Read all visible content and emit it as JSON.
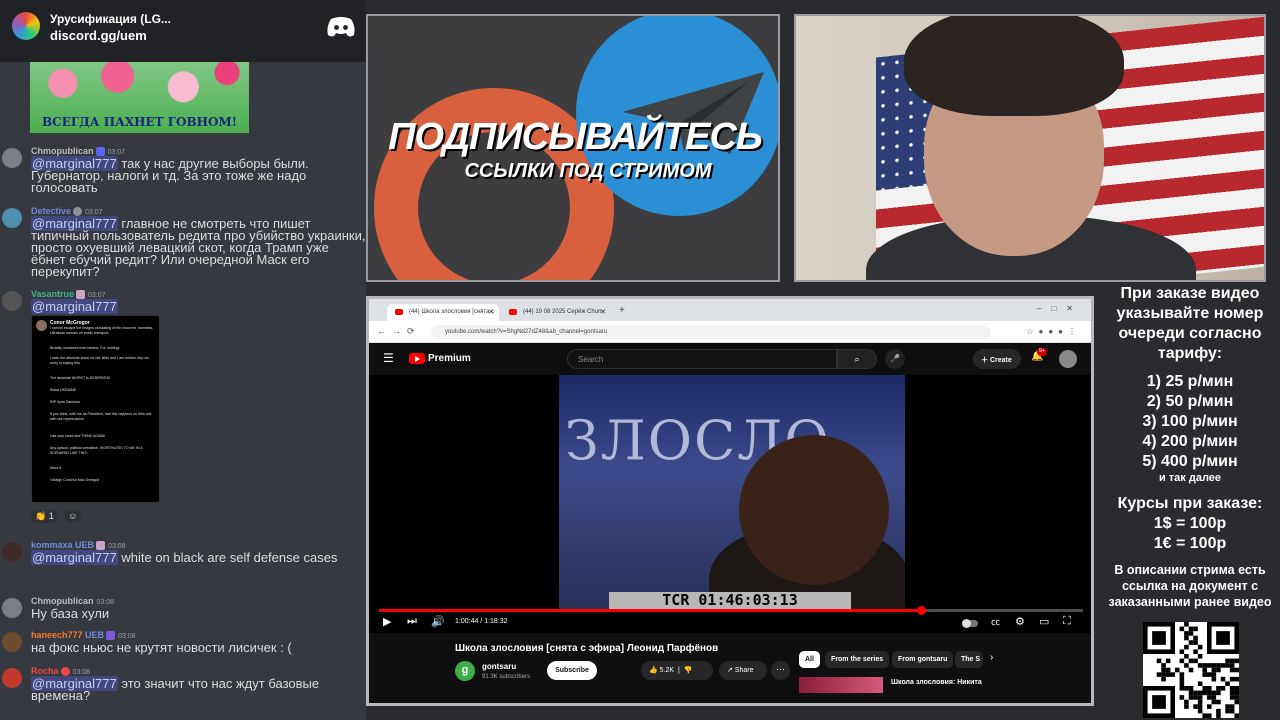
{
  "discord": {
    "server_name": "Урусификация (LG...",
    "invite_link": "discord.gg/uem",
    "image_caption": "ВСЕГДА ПАХНЕТ ГОВНОМ!",
    "messages": [
      {
        "author": "Chmopublican",
        "time": "03:07",
        "author_color": "#b9bbbe",
        "mention": "@marginal777",
        "text": " так у нас другие выборы были. Губернатор, налоги и тд. За это тоже же надо голосовать"
      },
      {
        "author": "Detective",
        "time": "03:07",
        "author_color": "#7289da",
        "mention": "@marginal777",
        "text": " главное не смотреть что пишет типичный пользователь редита про убийство украинки, просто охуевший левацкий скот, когда Трамп уже ёбнет ебучий редит? Или очередной Маск его перекупит?"
      },
      {
        "author": "Vasantrue",
        "time": "03:07",
        "author_color": "#43b581",
        "mention": "@marginal777",
        "text": ""
      },
      {
        "author": "kommaxa",
        "time": "03:08",
        "author_color": "#7289da",
        "tag": "UEB",
        "mention": "@marginal777",
        "text": " white on black are self defense cases"
      },
      {
        "author": "Chmopublican",
        "time": "03:08",
        "author_color": "#b9bbbe",
        "mention": "",
        "text": "Ну база хули"
      },
      {
        "author": "haneech777",
        "time": "03:08",
        "author_color": "#f47b2a",
        "tag": "UEB",
        "mention": "",
        "text": "на фокс ньюс не крутят новости лисичек : ("
      },
      {
        "author": "Rocha",
        "time": "03:08",
        "author_color": "#f04747",
        "mention": "@marginal777",
        "text": " это значит что нас ждут базовые времена?"
      }
    ],
    "tweet": {
      "author": "Conor McGregor",
      "lines": [
        "I cannot escape the images circulating of the innocent, harmless, Ukrainian woman on public transport.",
        "Brutally murdered from behind. For nothing!",
        "I wish the absolute worst for her killer and I am neither shy nor sorry in saying this.",
        "The absolute WORST is DESERVED!",
        "Slava UKRAINE",
        "RIP Iryna Zarutska",
        "If you think, with me as President, that this happens on Irish soil with out repercussion",
        "Use your head and THINK AGAIN!",
        "Any optical, political verbalism, WORTHLESS TO ME IN A SCENARIO LIKE THIS.",
        "Save it.",
        "Vótáigh Conchúr Mac Gréagóir"
      ]
    },
    "reactions": [
      "1"
    ]
  },
  "banner": {
    "title": "ПОДПИСЫВАЙТЕСЬ",
    "subtitle": "ССЫЛКИ ПОД СТРИМОМ"
  },
  "browser": {
    "tabs": [
      {
        "label": "(44) Школа злословия [снята с",
        "active": true
      },
      {
        "label": "(44) 19 08 2025 Серёж Chun",
        "active": false
      }
    ],
    "url": "youtube.com/watch?v=ShgNd27dZ48&ab_channel=gontsaru"
  },
  "youtube": {
    "brand": "Premium",
    "search_placeholder": "Search",
    "create_label": "Create",
    "notif_count": "9+",
    "time_display": "1:00:44 / 1:18:32",
    "tcr_overlay": "TCR 01:46:03:13",
    "frame_text": "ЗЛОСЛО",
    "progress": 0.77,
    "video_title": "Школа злословия [снята с эфира] Леонид Парфёнов",
    "channel_initial": "g",
    "channel_name": "gontsaru",
    "subscribers": "91.3K subscribers",
    "subscribe_label": "Subscribe",
    "likes": "5.2K",
    "share_label": "Share",
    "chips": [
      "All",
      "From the series",
      "From gontsaru",
      "The S"
    ],
    "rec_title": "Школа злословия: Никита"
  },
  "info": {
    "p1": "При заказе видео указывайте номер очереди согласно тарифу:",
    "tariffs": [
      "1) 25 р/мин",
      "2) 50 р/мин",
      "3) 100 р/мин",
      "4) 200 р/мин",
      "5) 400 р/мин"
    ],
    "etc": "и так далее",
    "courses_title": "Курсы при заказе:",
    "courses": [
      "1$ = 100р",
      "1€ = 100р"
    ],
    "p3": "В описании стрима есть ссылка на документ с заказанными ранее видео"
  }
}
